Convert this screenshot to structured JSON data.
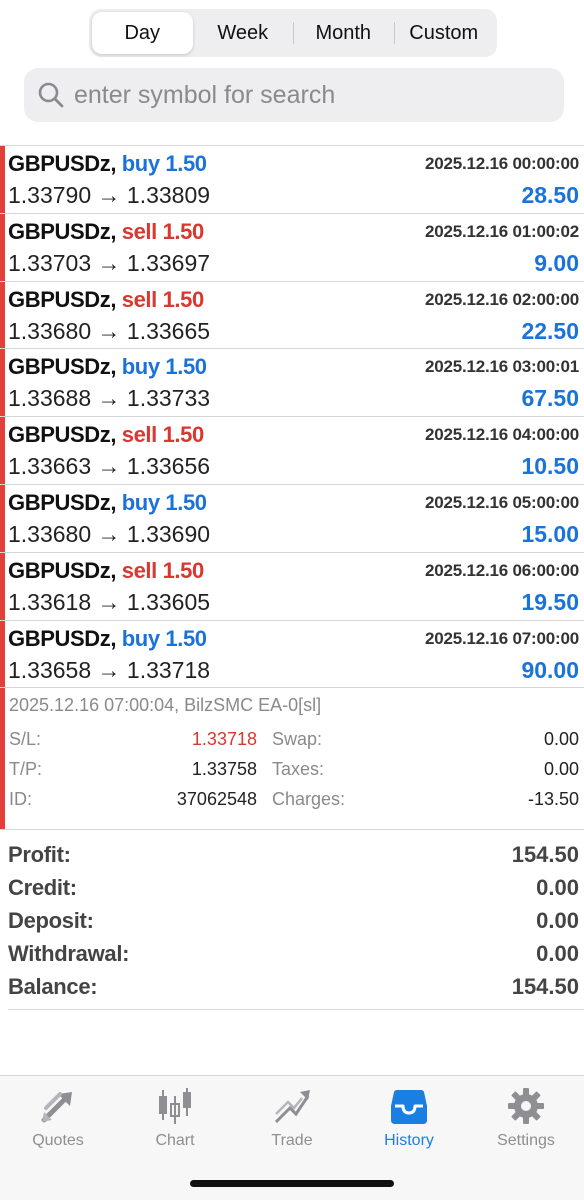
{
  "segments": [
    {
      "label": "Day",
      "active": true
    },
    {
      "label": "Week",
      "active": false
    },
    {
      "label": "Month",
      "active": false
    },
    {
      "label": "Custom",
      "active": false
    }
  ],
  "search": {
    "placeholder": "enter symbol for search",
    "value": ""
  },
  "deals": [
    {
      "symbol": "GBPUSDz,",
      "side": "buy",
      "volume": "1.50",
      "datetime": "2025.12.16 00:00:00",
      "open": "1.33790",
      "close": "1.33809",
      "profit": "28.50"
    },
    {
      "symbol": "GBPUSDz,",
      "side": "sell",
      "volume": "1.50",
      "datetime": "2025.12.16 01:00:02",
      "open": "1.33703",
      "close": "1.33697",
      "profit": "9.00"
    },
    {
      "symbol": "GBPUSDz,",
      "side": "sell",
      "volume": "1.50",
      "datetime": "2025.12.16 02:00:00",
      "open": "1.33680",
      "close": "1.33665",
      "profit": "22.50"
    },
    {
      "symbol": "GBPUSDz,",
      "side": "buy",
      "volume": "1.50",
      "datetime": "2025.12.16 03:00:01",
      "open": "1.33688",
      "close": "1.33733",
      "profit": "67.50"
    },
    {
      "symbol": "GBPUSDz,",
      "side": "sell",
      "volume": "1.50",
      "datetime": "2025.12.16 04:00:00",
      "open": "1.33663",
      "close": "1.33656",
      "profit": "10.50"
    },
    {
      "symbol": "GBPUSDz,",
      "side": "buy",
      "volume": "1.50",
      "datetime": "2025.12.16 05:00:00",
      "open": "1.33680",
      "close": "1.33690",
      "profit": "15.00"
    },
    {
      "symbol": "GBPUSDz,",
      "side": "sell",
      "volume": "1.50",
      "datetime": "2025.12.16 06:00:00",
      "open": "1.33618",
      "close": "1.33605",
      "profit": "19.50"
    },
    {
      "symbol": "GBPUSDz,",
      "side": "buy",
      "volume": "1.50",
      "datetime": "2025.12.16 07:00:00",
      "open": "1.33658",
      "close": "1.33718",
      "profit": "90.00"
    }
  ],
  "arrow": "→",
  "details": {
    "comment": "2025.12.16 07:00:04, BilzSMC EA-0[sl]",
    "rows": [
      {
        "k1": "S/L:",
        "v1": "1.33718",
        "k2": "Swap:",
        "v2": "0.00"
      },
      {
        "k1": "T/P:",
        "v1": "1.33758",
        "k2": "Taxes:",
        "v2": "0.00"
      },
      {
        "k1": "ID:",
        "v1": "37062548",
        "k2": "Charges:",
        "v2": "-13.50"
      }
    ]
  },
  "summary": [
    {
      "label": "Profit:",
      "value": "154.50"
    },
    {
      "label": "Credit:",
      "value": "0.00"
    },
    {
      "label": "Deposit:",
      "value": "0.00"
    },
    {
      "label": "Withdrawal:",
      "value": "0.00"
    },
    {
      "label": "Balance:",
      "value": "154.50"
    }
  ],
  "tabs": [
    {
      "label": "Quotes",
      "icon": "quotes-arrows-icon",
      "active": false
    },
    {
      "label": "Chart",
      "icon": "candlestick-icon",
      "active": false
    },
    {
      "label": "Trade",
      "icon": "trend-up-icon",
      "active": false
    },
    {
      "label": "History",
      "icon": "inbox-icon",
      "active": true
    },
    {
      "label": "Settings",
      "icon": "gear-icon",
      "active": false
    }
  ],
  "colors": {
    "buy": "#1a73d9",
    "sell": "#d9372f",
    "accent": "#1a7fe3",
    "bar": "#e2403a"
  }
}
